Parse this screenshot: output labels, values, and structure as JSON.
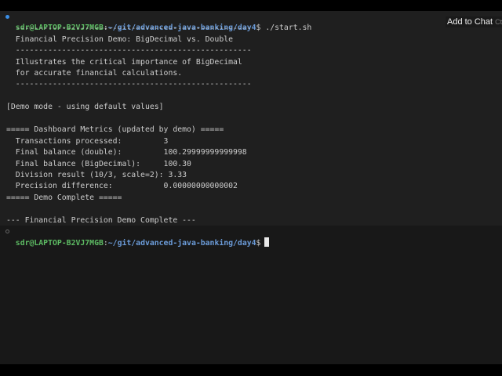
{
  "prompt": {
    "user_host": "sdr@LAPTOP-B2VJ7MGB",
    "sep": ":",
    "path": "~/git/advanced-java-banking/day4",
    "symbol": "$"
  },
  "command": " ./start.sh",
  "tooltip": {
    "label": "Add to Chat",
    "shortcut": "Ctrl"
  },
  "output": [
    "  ---------------------------------------------------",
    "  Financial Precision Demo: BigDecimal vs. Double",
    "  ---------------------------------------------------",
    "  Illustrates the critical importance of BigDecimal",
    "  for accurate financial calculations.",
    "  ---------------------------------------------------",
    "[Demo mode - using default values]",
    "===== Dashboard Metrics (updated by demo) =====",
    "  Transactions processed:         3",
    "  Final balance (double):         100.29999999999998",
    "  Final balance (BigDecimal):     100.30",
    "  Division result (10/3, scale=2): 3.33",
    "  Precision difference:           0.00000000000002",
    "===== Demo Complete =====",
    "--- Financial Precision Demo Complete ---"
  ]
}
